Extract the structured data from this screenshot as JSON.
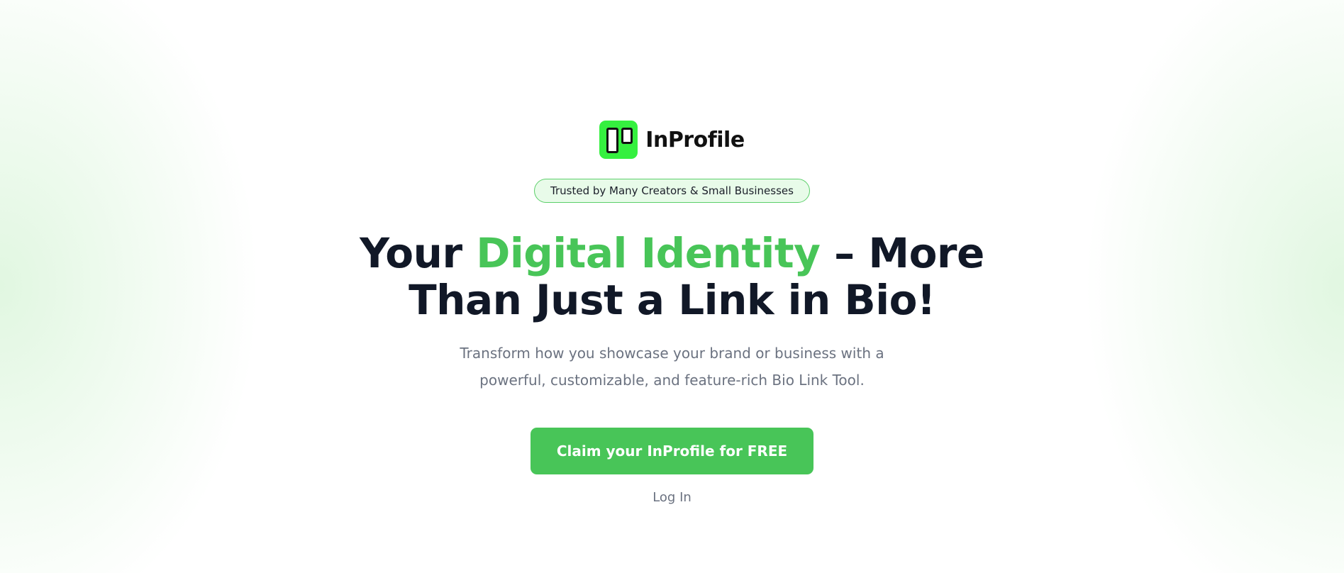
{
  "brand": {
    "name": "InProfile",
    "logo_icon": "inprofile-logo-icon",
    "logo_color": "#35f03f"
  },
  "badge": {
    "text": "Trusted by Many Creators & Small Businesses"
  },
  "headline": {
    "part1": "Your ",
    "accent": "Digital Identity",
    "part2": " – More Than Just a Link in Bio!",
    "accent_color": "#48c558",
    "text_color": "#111827"
  },
  "subtitle": "Transform how you showcase your brand or business with a powerful, customizable, and feature-rich Bio Link Tool.",
  "cta": {
    "label": "Claim your InProfile for FREE",
    "color": "#48c558"
  },
  "login": {
    "label": "Log In"
  }
}
